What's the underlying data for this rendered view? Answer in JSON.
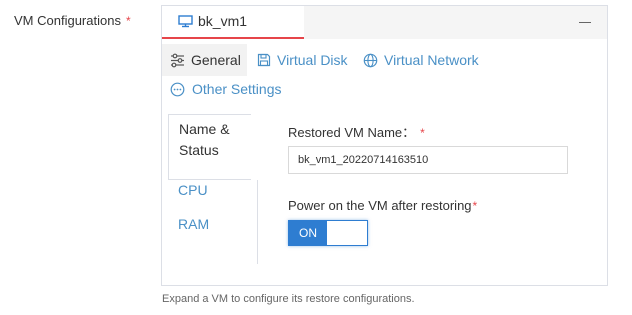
{
  "field": {
    "label": "VM Configurations",
    "required_mark": "*"
  },
  "vm_tab": {
    "name": "bk_vm1",
    "icon": "monitor-icon"
  },
  "collapse": {
    "icon": "minimize-icon"
  },
  "tabs": [
    {
      "label": "General",
      "icon": "sliders-icon",
      "active": true
    },
    {
      "label": "Virtual Disk",
      "icon": "floppy-disk-icon",
      "active": false
    },
    {
      "label": "Virtual Network",
      "icon": "globe-icon",
      "active": false
    },
    {
      "label": "Other Settings",
      "icon": "more-circle-icon",
      "active": false
    }
  ],
  "sections": [
    {
      "label": "Name &\nStatus",
      "active": true
    },
    {
      "label": "CPU",
      "active": false
    },
    {
      "label": "RAM",
      "active": false
    }
  ],
  "form": {
    "name_label": "Restored VM Name：",
    "name_required": "*",
    "name_value": "bk_vm1_20220714163510",
    "power_label": "Power on the VM after restoring",
    "power_required": "*",
    "power_toggle_label": "ON",
    "power_on": true
  },
  "help": "Expand a VM to configure its restore configurations.",
  "colors": {
    "accent_red": "#e6454a",
    "link_blue": "#4a90c6",
    "toggle_blue": "#2e7dd1"
  }
}
